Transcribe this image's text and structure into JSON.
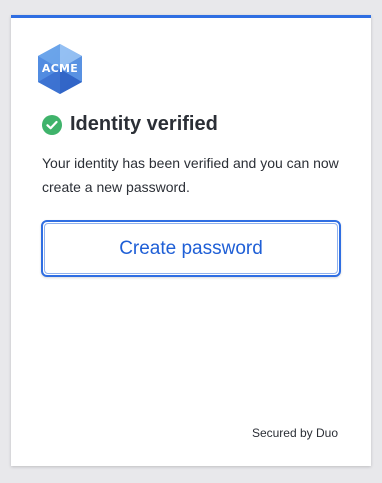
{
  "brand": {
    "logo_text": "ACME",
    "logo_icon": "acme-hexagon-logo",
    "accent_color": "#2f6ee2"
  },
  "heading": {
    "icon": "check-circle-icon",
    "icon_color": "#3fb36b",
    "title": "Identity verified"
  },
  "message": "Your identity has been verified and you can now create a new password.",
  "actions": {
    "create_password_label": "Create password"
  },
  "footer": {
    "secured_by": "Secured by Duo"
  }
}
